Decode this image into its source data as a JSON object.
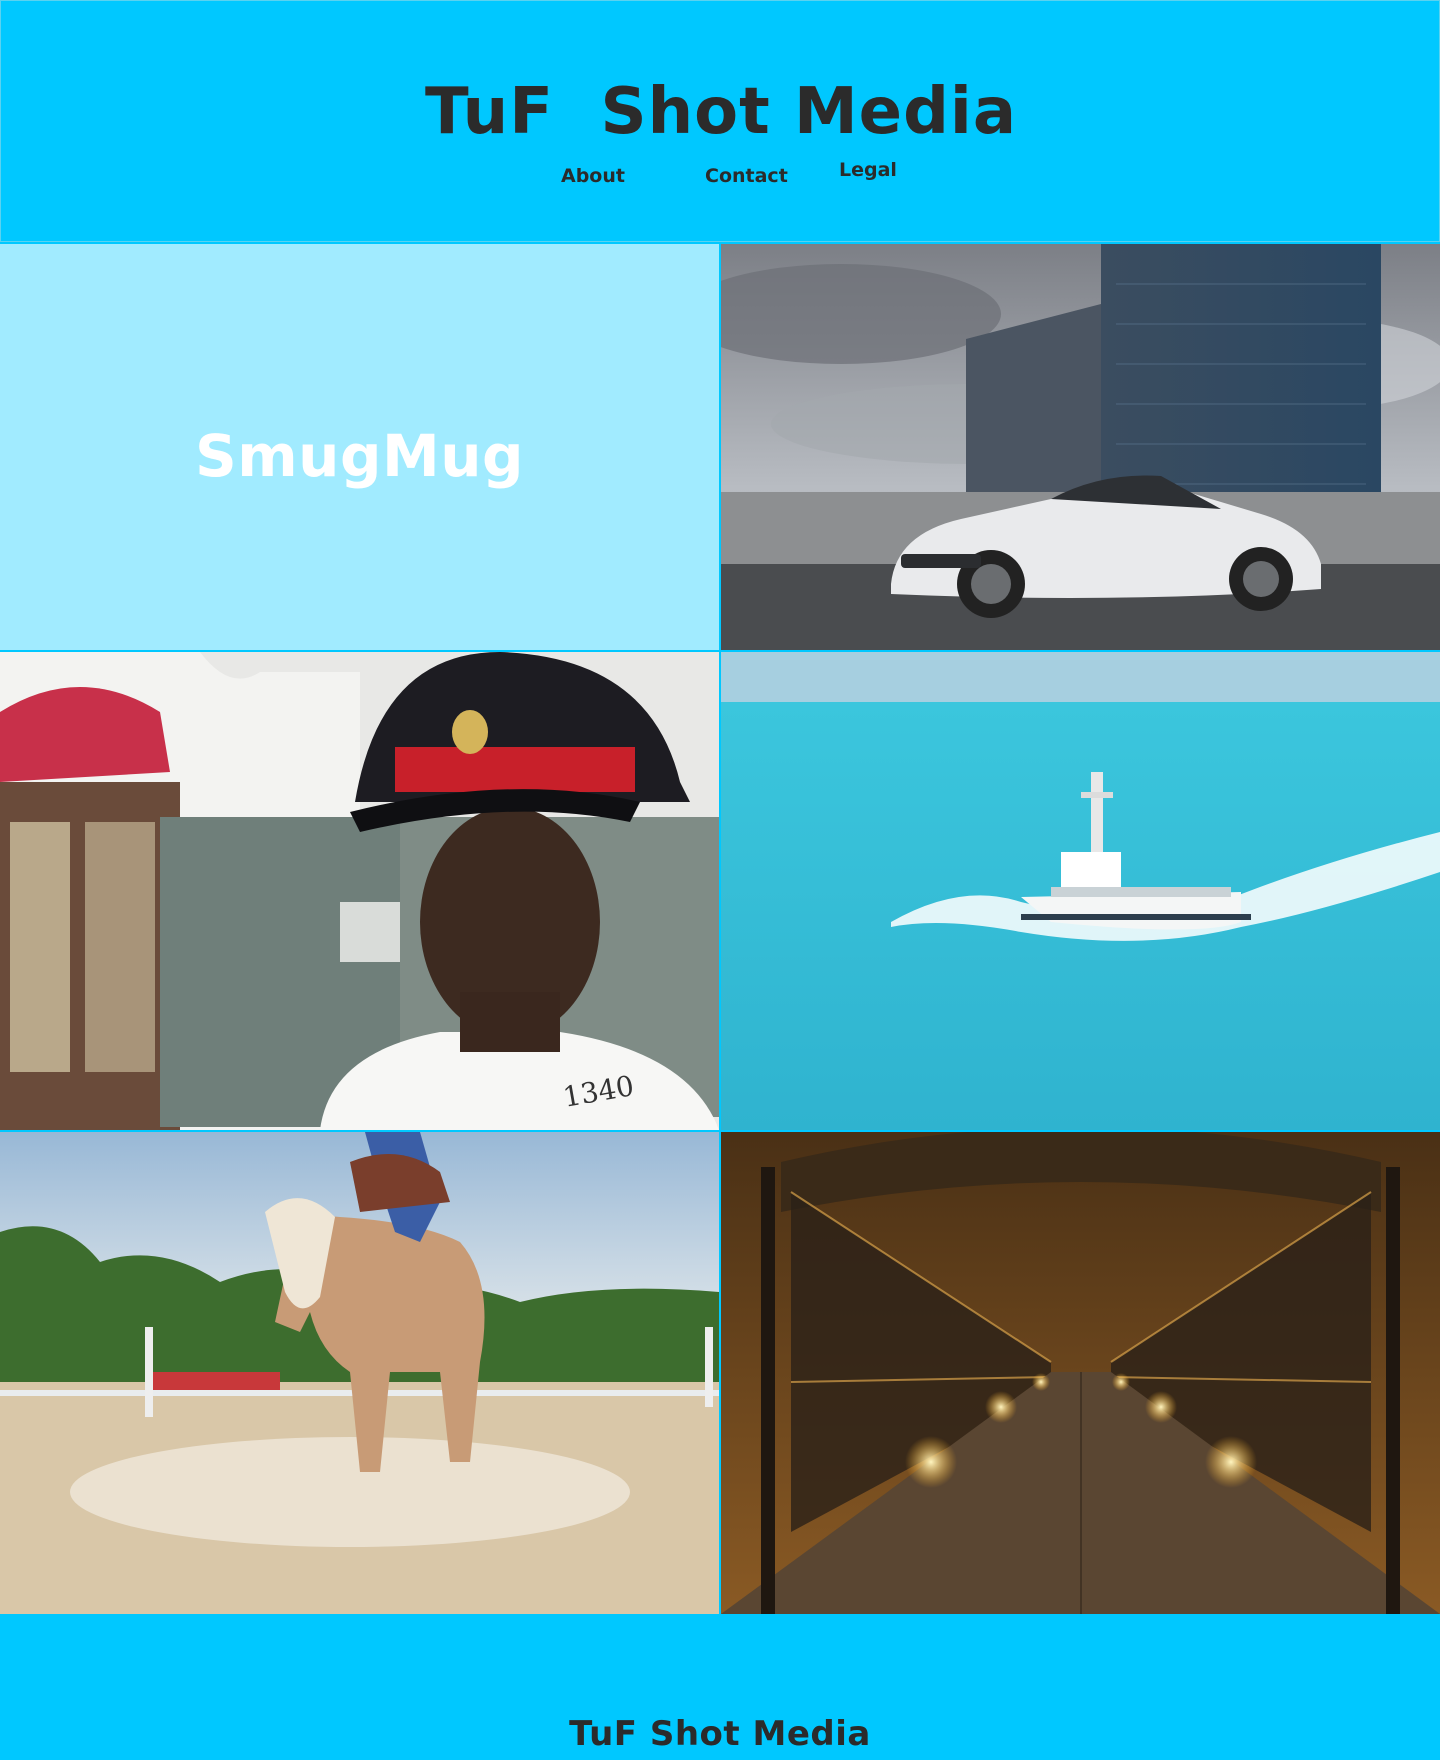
{
  "header": {
    "title": "TuF  Shot Media",
    "nav": {
      "about": "About",
      "contact": "Contact",
      "legal": "Legal"
    }
  },
  "gallery": {
    "smugmug_label": "SmugMug",
    "photos": [
      "car-photo",
      "guard-photo",
      "boat-photo",
      "horse-photo",
      "bridge-photo"
    ]
  },
  "footer": {
    "title": "TuF Shot Media"
  },
  "colors": {
    "brand_blue": "#00c8ff",
    "light_blue": "#a1ebff",
    "text_dark": "#2b2b2b"
  }
}
